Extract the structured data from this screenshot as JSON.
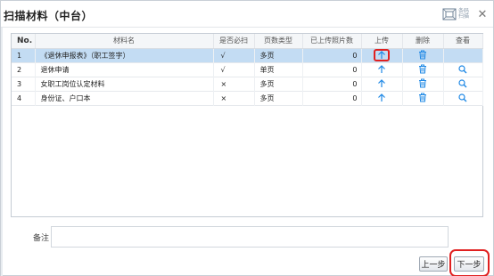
{
  "dialog": {
    "title": "扫描材料（中台）",
    "qr_icon_text": [
      "条码",
      "扫描"
    ],
    "close_glyph": "✕"
  },
  "table": {
    "headers": {
      "no": "No.",
      "name": "材料名",
      "required": "是否必扫",
      "page_type": "页数类型",
      "uploaded_count": "已上传照片数",
      "upload": "上传",
      "delete": "删除",
      "view": "查看"
    },
    "rows": [
      {
        "no": "1",
        "name": "《退休申报表》（职工签字）",
        "required": "√",
        "page_type": "多页",
        "uploaded_count": "0",
        "selected": true
      },
      {
        "no": "2",
        "name": "退休申请",
        "required": "√",
        "page_type": "单页",
        "uploaded_count": "0",
        "selected": false
      },
      {
        "no": "3",
        "name": "女职工岗位认定材料",
        "required": "×",
        "page_type": "多页",
        "uploaded_count": "0",
        "selected": false
      },
      {
        "no": "4",
        "name": "身份证、户口本",
        "required": "×",
        "page_type": "多页",
        "uploaded_count": "0",
        "selected": false
      }
    ]
  },
  "remark": {
    "label": "备注",
    "value": ""
  },
  "buttons": {
    "prev": "上一步",
    "next": "下一步"
  },
  "colors": {
    "accent_icon": "#1e88e5",
    "selected_row": "#c3dcf3",
    "highlight": "#e02020"
  },
  "icons": {
    "upload": "arrow-up-icon",
    "delete": "trash-icon",
    "view": "magnifier-icon",
    "restore": "restore-window-icon",
    "qr": "barcode-scan-icon",
    "close": "close-icon"
  }
}
